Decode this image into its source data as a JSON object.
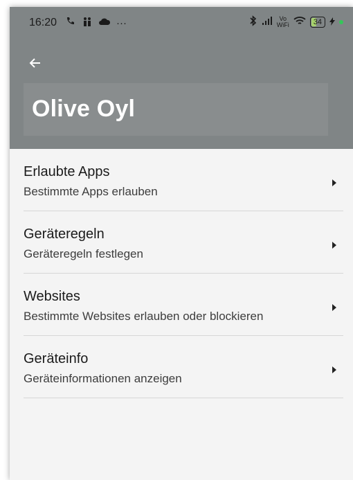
{
  "status": {
    "time": "16:20",
    "left_icons": [
      "phone-icon",
      "family-icon",
      "cloud-icon",
      "more-icon"
    ],
    "more_dots": "···",
    "battery": "34",
    "vowifi_top": "Vo",
    "vowifi_bottom": "WiFi"
  },
  "header": {
    "title": "Olive Oyl",
    "back_icon": "back-arrow-icon",
    "background": "#808586"
  },
  "menu": {
    "items": [
      {
        "title": "Erlaubte Apps",
        "subtitle": "Bestimmte Apps erlauben"
      },
      {
        "title": "Geräteregeln",
        "subtitle": "Geräteregeln festlegen"
      },
      {
        "title": "Websites",
        "subtitle": "Bestimmte Websites erlauben oder blockieren"
      },
      {
        "title": "Geräteinfo",
        "subtitle": "Geräteinformationen anzeigen"
      }
    ]
  }
}
